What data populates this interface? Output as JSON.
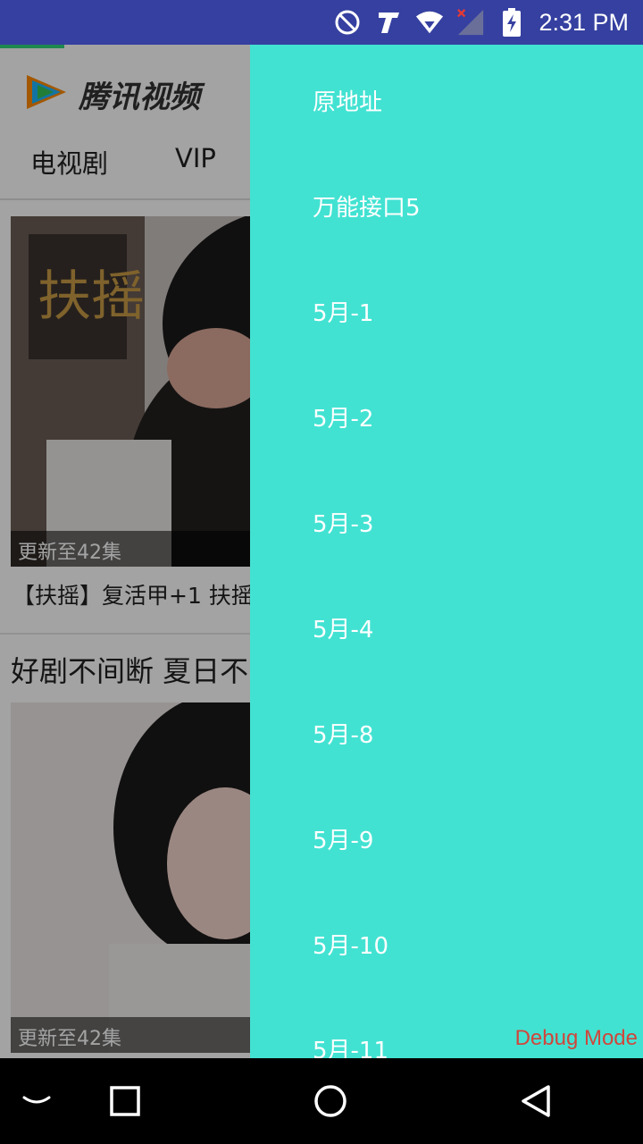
{
  "status_bar": {
    "time": "2:31 PM",
    "icons": [
      "dnd-icon",
      "t-app-icon",
      "wifi-icon",
      "signal-icon",
      "battery-charging-icon"
    ]
  },
  "app": {
    "name": "腾讯视频",
    "tabs": [
      "电视剧",
      "VIP"
    ],
    "card1": {
      "poster_title": "扶摇",
      "badge": "更新至42集",
      "title": "【扶摇】复活甲+1 扶摇"
    },
    "section_title": "好剧不间断 夏日不",
    "card2": {
      "badge": "更新至42集"
    }
  },
  "drawer": {
    "items": [
      "原地址",
      "万能接口5",
      "5月-1",
      "5月-2",
      "5月-3",
      "5月-4",
      "5月-8",
      "5月-9",
      "5月-10",
      "5月-11"
    ]
  },
  "debug_label": "Debug Mode",
  "nav_bar": {
    "buttons": [
      "keyboard-hide-icon",
      "recents-icon",
      "home-icon",
      "back-icon"
    ]
  },
  "colors": {
    "status_bar": "#3540a0",
    "drawer": "#42e2d2",
    "debug": "#d0463c"
  }
}
